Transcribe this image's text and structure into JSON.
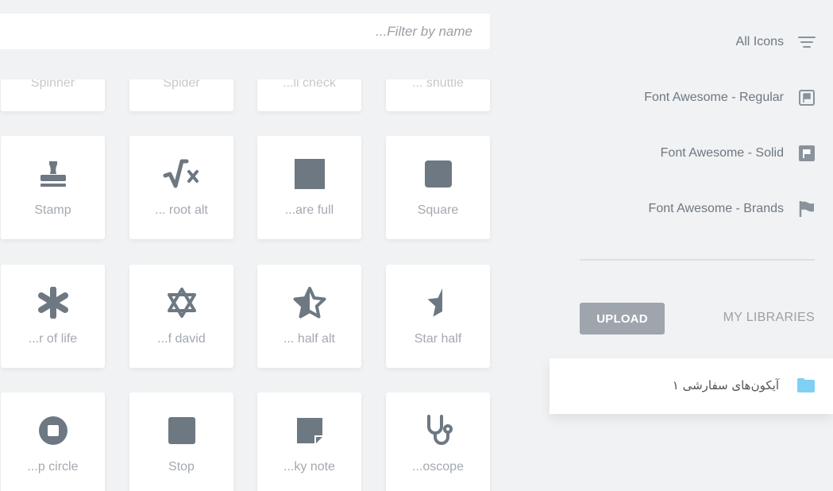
{
  "filter": {
    "placeholder": "...Filter by name"
  },
  "icons": [
    {
      "label": "Spinner",
      "icon": "spinner-icon"
    },
    {
      "label": "Spider",
      "icon": "spider-icon"
    },
    {
      "label": "...ll check",
      "icon": "spell-check-icon"
    },
    {
      "label": "... shuttle",
      "icon": "space-shuttle-icon"
    },
    {
      "label": "Stamp",
      "icon": "stamp-icon"
    },
    {
      "label": "... root alt",
      "icon": "square-root-alt-icon"
    },
    {
      "label": "...are full",
      "icon": "square-full-icon"
    },
    {
      "label": "Square",
      "icon": "square-icon"
    },
    {
      "label": "...r of life",
      "icon": "star-of-life-icon"
    },
    {
      "label": "...f david",
      "icon": "star-of-david-icon"
    },
    {
      "label": "... half alt",
      "icon": "star-half-alt-icon"
    },
    {
      "label": "Star half",
      "icon": "star-half-icon"
    },
    {
      "label": "...p circle",
      "icon": "stop-circle-icon"
    },
    {
      "label": "Stop",
      "icon": "stop-icon"
    },
    {
      "label": "...ky note",
      "icon": "sticky-note-icon"
    },
    {
      "label": "...oscope",
      "icon": "stethoscope-icon"
    }
  ],
  "sidebar": {
    "categories": [
      {
        "label": "All Icons",
        "icon": "filter-lines-icon"
      },
      {
        "label": "Font Awesome - Regular",
        "icon": "flag-regular-icon"
      },
      {
        "label": "Font Awesome - Solid",
        "icon": "flag-solid-icon"
      },
      {
        "label": "Font Awesome - Brands",
        "icon": "flag-brands-icon"
      }
    ],
    "upload_label": "UPLOAD",
    "my_libraries_label": "MY LIBRARIES",
    "folder": {
      "name": "آیکون‌های سفارشی ۱",
      "icon": "folder-icon"
    }
  },
  "colors": {
    "icon": "#6d7882",
    "folder": "#7fd0f4",
    "upload_bg": "#9ea5ac"
  }
}
